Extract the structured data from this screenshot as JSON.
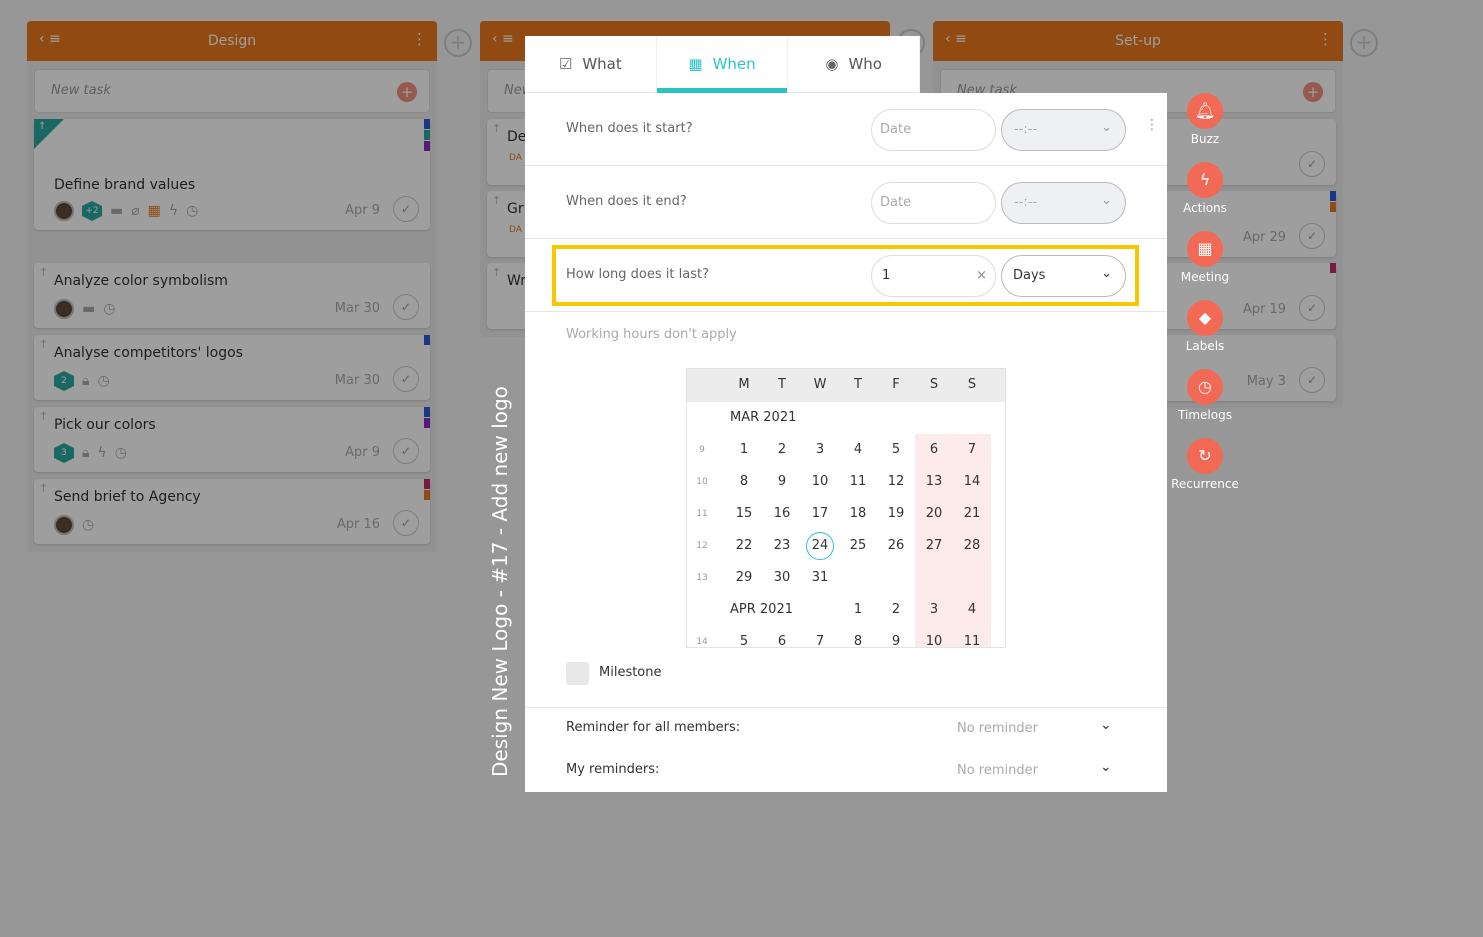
{
  "board": {
    "columns": [
      {
        "title": "Design",
        "new_task": "New task",
        "cards": [
          {
            "title": "Define brand values",
            "date": "Apr 9",
            "members_extra": "+2"
          },
          {
            "title": "Analyze color symbolism",
            "date": "Mar 30"
          },
          {
            "title": "Analyse competitors' logos",
            "date": "Mar 30",
            "badge": "2"
          },
          {
            "title": "Pick our colors",
            "date": "Apr 9",
            "badge": "3"
          },
          {
            "title": "Send brief to Agency",
            "date": "Apr 16"
          }
        ]
      },
      {
        "title": "",
        "new_task": "New task",
        "cards": [
          {
            "title": "De",
            "badge": "DA"
          },
          {
            "title": "Gr",
            "badge": "DA"
          },
          {
            "title": "Wr"
          }
        ]
      },
      {
        "title": "Set-up",
        "new_task": "New task",
        "cards": [
          {
            "date": ""
          },
          {
            "date": "Apr 29"
          },
          {
            "date": "Apr 19"
          },
          {
            "date": "May 3"
          }
        ]
      }
    ]
  },
  "task_title": "Design New Logo - #17 - Add new logo",
  "tabs": [
    {
      "label": "What",
      "icon": "clipboard-check-icon"
    },
    {
      "label": "When",
      "icon": "calendar-icon",
      "active": true
    },
    {
      "label": "Who",
      "icon": "user-circle-icon"
    }
  ],
  "when": {
    "start": {
      "label": "When does it start?",
      "date_placeholder": "Date",
      "time_placeholder": "--:--"
    },
    "end": {
      "label": "When does it end?",
      "date_placeholder": "Date",
      "time_placeholder": "--:--"
    },
    "duration": {
      "label": "How long does it last?",
      "value": "1",
      "unit": "Days"
    },
    "working_hours_note": "Working hours don't apply",
    "calendar": {
      "weekdays": [
        "M",
        "T",
        "W",
        "T",
        "F",
        "S",
        "S"
      ],
      "today": 24,
      "rows": [
        {
          "month": "MAR 2021"
        },
        {
          "week": "9",
          "days": [
            1,
            2,
            3,
            4,
            5,
            6,
            7
          ]
        },
        {
          "week": "10",
          "days": [
            8,
            9,
            10,
            11,
            12,
            13,
            14
          ]
        },
        {
          "week": "11",
          "days": [
            15,
            16,
            17,
            18,
            19,
            20,
            21
          ]
        },
        {
          "week": "12",
          "days": [
            22,
            23,
            24,
            25,
            26,
            27,
            28
          ]
        },
        {
          "week": "13",
          "days": [
            29,
            30,
            31,
            null,
            null,
            null,
            null
          ]
        },
        {
          "month": "APR 2021",
          "days": [
            null,
            null,
            null,
            1,
            2,
            3,
            4
          ]
        },
        {
          "week": "14",
          "days": [
            5,
            6,
            7,
            8,
            9,
            10,
            11
          ]
        }
      ]
    },
    "milestone_label": "Milestone",
    "milestone_checked": false,
    "reminder_all": {
      "label": "Reminder for all members:",
      "value": "No reminder"
    },
    "my_reminders": {
      "label": "My reminders:",
      "value": "No reminder"
    }
  },
  "actions": [
    {
      "label": "Buzz",
      "icon": "bell-icon"
    },
    {
      "label": "Actions",
      "icon": "lightning-icon"
    },
    {
      "label": "Meeting",
      "icon": "calendar-icon"
    },
    {
      "label": "Labels",
      "icon": "tag-icon"
    },
    {
      "label": "Timelogs",
      "icon": "clock-icon"
    },
    {
      "label": "Recurrence",
      "icon": "refresh-icon"
    }
  ],
  "colors": {
    "accent": "#2bc4c4",
    "column_header": "#e8781e",
    "action": "#f26a55",
    "highlight": "#f7c800"
  }
}
